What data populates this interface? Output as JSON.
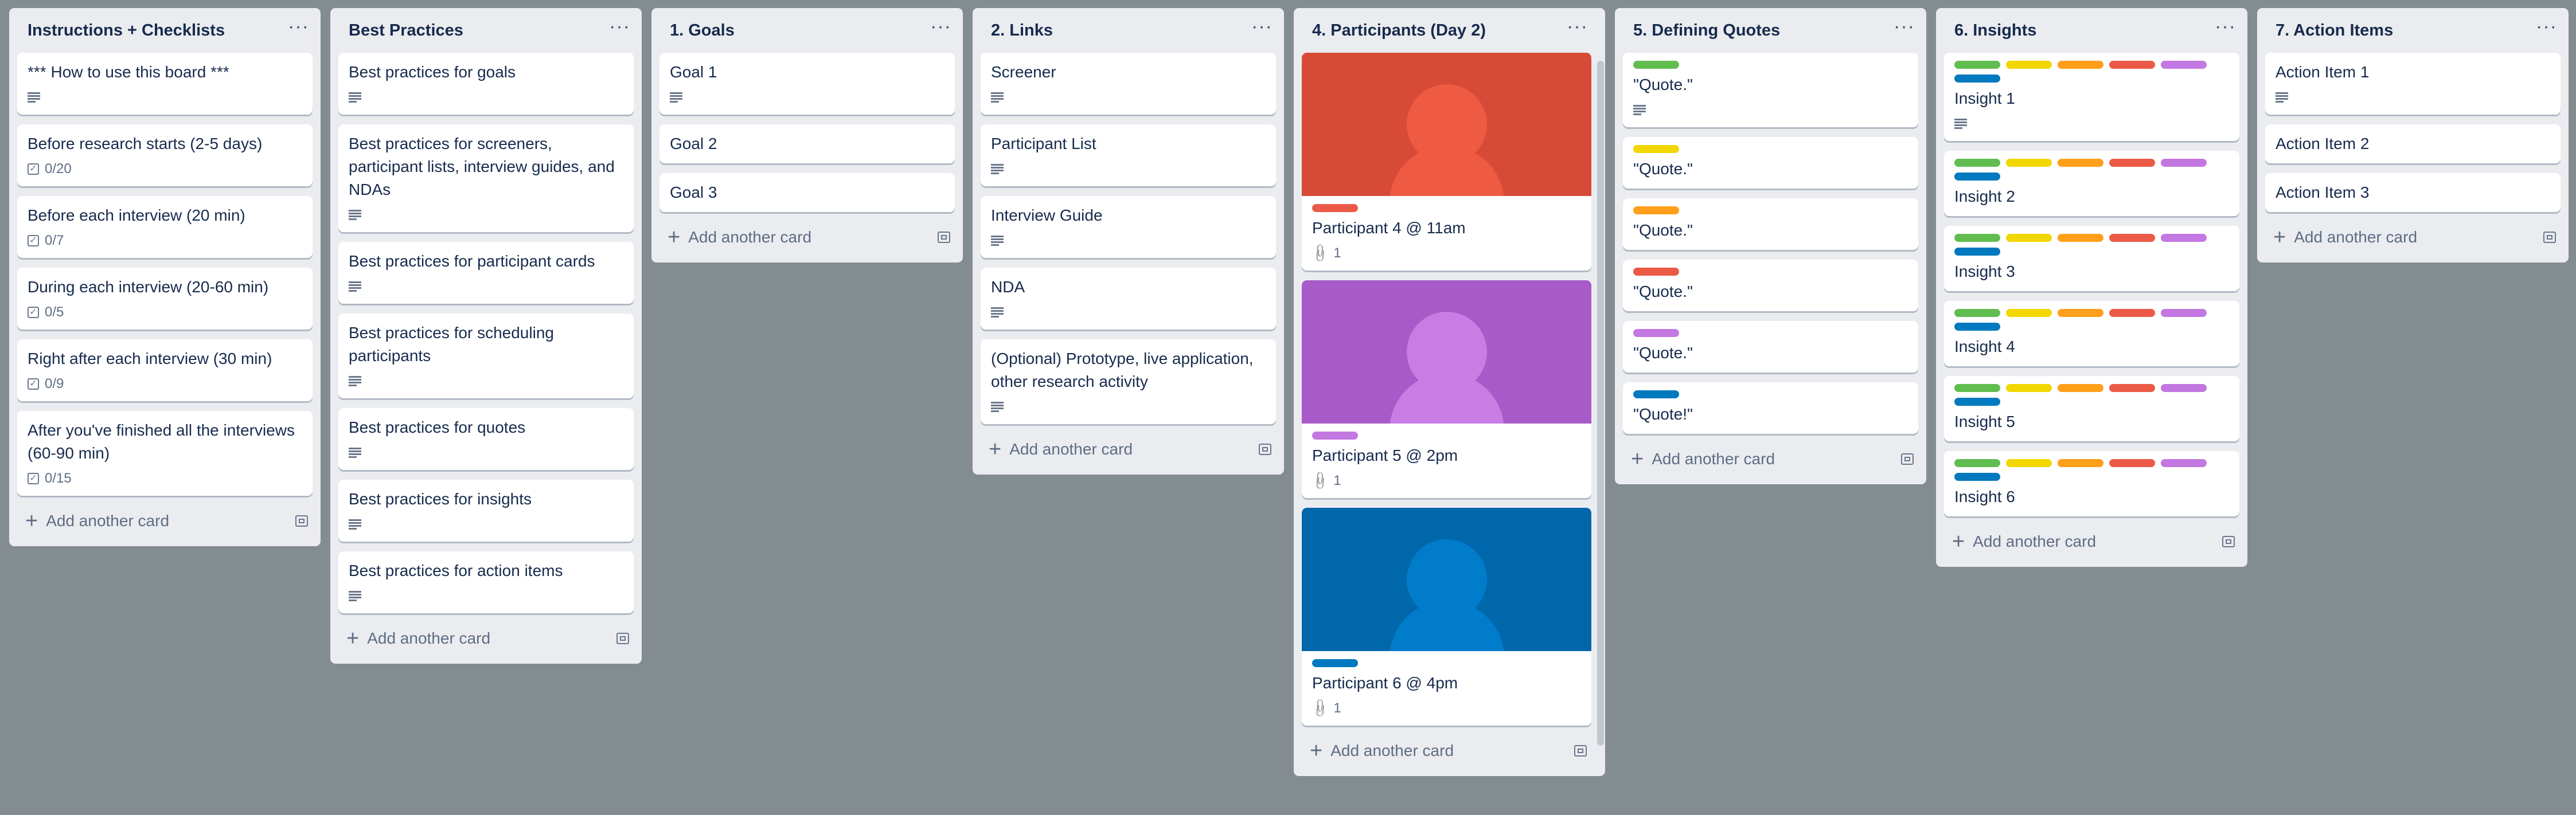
{
  "label_colors": {
    "green": "#61bd4f",
    "yellow": "#f2d600",
    "orange": "#ff9f1a",
    "red": "#eb5a46",
    "purple": "#c377e0",
    "blue": "#0079bf"
  },
  "add_card_label": "Add another card",
  "lists": [
    {
      "title": "Instructions + Checklists",
      "cards": [
        {
          "title": "*** How to use this board ***",
          "description": true
        },
        {
          "title": "Before research starts (2-5 days)",
          "checklist": "0/20"
        },
        {
          "title": "Before each interview (20 min)",
          "checklist": "0/7"
        },
        {
          "title": "During each interview (20-60 min)",
          "checklist": "0/5"
        },
        {
          "title": "Right after each interview (30 min)",
          "checklist": "0/9"
        },
        {
          "title": "After you've finished all the interviews (60-90 min)",
          "checklist": "0/15"
        }
      ]
    },
    {
      "title": "Best Practices",
      "cards": [
        {
          "title": "Best practices for goals",
          "description": true
        },
        {
          "title": "Best practices for screeners, participant lists, interview guides, and NDAs",
          "description": true
        },
        {
          "title": "Best practices for participant cards",
          "description": true
        },
        {
          "title": "Best practices for scheduling participants",
          "description": true
        },
        {
          "title": "Best practices for quotes",
          "description": true
        },
        {
          "title": "Best practices for insights",
          "description": true
        },
        {
          "title": "Best practices for action items",
          "description": true
        }
      ]
    },
    {
      "title": "1. Goals",
      "cards": [
        {
          "title": "Goal 1",
          "description": true
        },
        {
          "title": "Goal 2"
        },
        {
          "title": "Goal 3"
        }
      ]
    },
    {
      "title": "2. Links",
      "cards": [
        {
          "title": "Screener",
          "description": true
        },
        {
          "title": "Participant List",
          "description": true
        },
        {
          "title": "Interview Guide",
          "description": true
        },
        {
          "title": "NDA",
          "description": true
        },
        {
          "title": "(Optional) Prototype, live application, other research activity",
          "description": true
        }
      ]
    },
    {
      "title": "4. Participants (Day 2)",
      "cards": [
        {
          "title": "Participant 4 @ 11am",
          "cover": "red",
          "labels": [
            "red"
          ],
          "attachments": "1"
        },
        {
          "title": "Participant 5 @ 2pm",
          "cover": "purple",
          "labels": [
            "purple"
          ],
          "attachments": "1"
        },
        {
          "title": "Participant 6 @ 4pm",
          "cover": "blue",
          "labels": [
            "blue"
          ],
          "attachments": "1"
        }
      ]
    },
    {
      "title": "5. Defining Quotes",
      "cards": [
        {
          "title": "\"Quote.\"",
          "labels": [
            "green"
          ],
          "description": true
        },
        {
          "title": "\"Quote.\"",
          "labels": [
            "yellow"
          ]
        },
        {
          "title": "\"Quote.\"",
          "labels": [
            "orange"
          ]
        },
        {
          "title": "\"Quote.\"",
          "labels": [
            "red"
          ]
        },
        {
          "title": "\"Quote.\"",
          "labels": [
            "purple"
          ]
        },
        {
          "title": "\"Quote!\"",
          "labels": [
            "blue"
          ]
        }
      ]
    },
    {
      "title": "6. Insights",
      "cards": [
        {
          "title": "Insight 1",
          "labels": [
            "green",
            "yellow",
            "orange",
            "red",
            "purple",
            "blue"
          ],
          "description": true
        },
        {
          "title": "Insight 2",
          "labels": [
            "green",
            "yellow",
            "orange",
            "red",
            "purple",
            "blue"
          ]
        },
        {
          "title": "Insight 3",
          "labels": [
            "green",
            "yellow",
            "orange",
            "red",
            "purple",
            "blue"
          ]
        },
        {
          "title": "Insight 4",
          "labels": [
            "green",
            "yellow",
            "orange",
            "red",
            "purple",
            "blue"
          ]
        },
        {
          "title": "Insight 5",
          "labels": [
            "green",
            "yellow",
            "orange",
            "red",
            "purple",
            "blue"
          ]
        },
        {
          "title": "Insight 6",
          "labels": [
            "green",
            "yellow",
            "orange",
            "red",
            "purple",
            "blue"
          ]
        }
      ]
    },
    {
      "title": "7. Action Items",
      "cards": [
        {
          "title": "Action Item 1",
          "description": true
        },
        {
          "title": "Action Item 2"
        },
        {
          "title": "Action Item 3"
        }
      ]
    }
  ]
}
